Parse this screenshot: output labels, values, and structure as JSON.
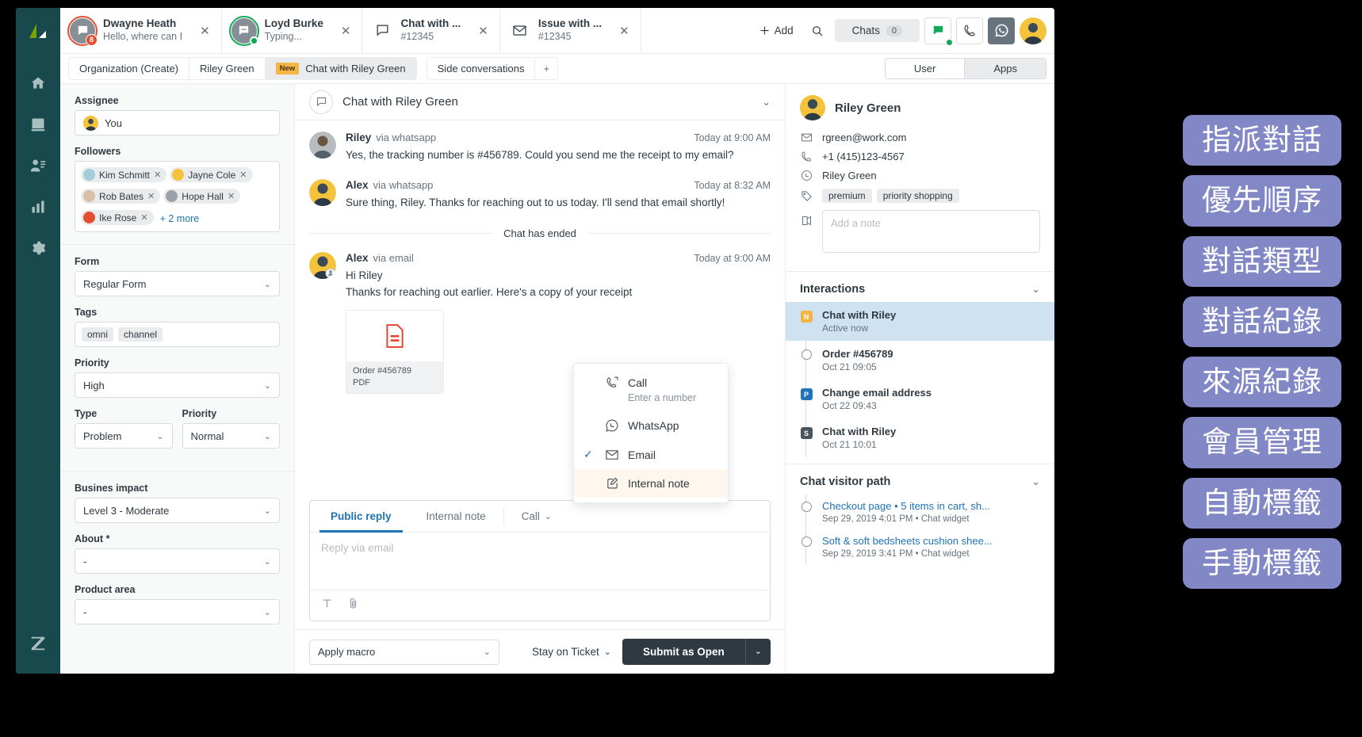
{
  "rail": {
    "items": [
      {
        "name": "logo",
        "label": "Zendesk logo"
      },
      {
        "name": "home",
        "label": "Home"
      },
      {
        "name": "views",
        "label": "Views"
      },
      {
        "name": "customers",
        "label": "Customers"
      },
      {
        "name": "reporting",
        "label": "Reporting"
      },
      {
        "name": "admin",
        "label": "Admin"
      }
    ],
    "bottom_label": "Zendesk"
  },
  "top_tabs": [
    {
      "title": "Dwayne Heath",
      "sub": "Hello, where can I",
      "badge": "8",
      "kind": "avatar-red"
    },
    {
      "title": "Loyd Burke",
      "sub": "Typing...",
      "badge": "",
      "kind": "avatar-green"
    },
    {
      "title": "Chat with ...",
      "sub": "#12345",
      "badge": "",
      "kind": "chat-icon"
    },
    {
      "title": "Issue with ...",
      "sub": "#12345",
      "badge": "",
      "kind": "mail-icon"
    }
  ],
  "top_actions": {
    "add_label": "Add",
    "search_label": "search-icon",
    "chats_label": "Chats",
    "chats_count": "0"
  },
  "crumbs": {
    "items": [
      {
        "label": "Organization (Create)",
        "active": false,
        "badge": ""
      },
      {
        "label": "Riley Green",
        "active": false,
        "badge": ""
      },
      {
        "label": "Chat with Riley Green",
        "active": true,
        "badge": "New"
      }
    ],
    "side_conversations": "Side conversations",
    "add": "+",
    "segment": {
      "left": "User",
      "right": "Apps",
      "selected": "Apps"
    }
  },
  "props": {
    "assignee_label": "Assignee",
    "assignee_value": "You",
    "followers_label": "Followers",
    "followers": [
      {
        "name": "Kim Schmitt",
        "color": "#a3cdd9"
      },
      {
        "name": "Jayne Cole",
        "color": "#f5c33b"
      },
      {
        "name": "Rob Bates",
        "color": "#d9bfa8"
      },
      {
        "name": "Hope Hall",
        "color": "#9aa2a8"
      },
      {
        "name": "Ike Rose",
        "color": "#e34f32"
      }
    ],
    "followers_more": "+ 2 more",
    "form_label": "Form",
    "form_value": "Regular Form",
    "tags_label": "Tags",
    "tags": [
      "omni",
      "channel"
    ],
    "priority_label": "Priority",
    "priority_value": "High",
    "type_label": "Type",
    "type_value": "Problem",
    "priority2_label": "Priority",
    "priority2_value": "Normal",
    "business_impact_label": "Busines impact",
    "business_impact_value": "Level 3 - Moderate",
    "about_label": "About *",
    "about_value": "-",
    "product_area_label": "Product area",
    "product_area_value": "-"
  },
  "conversation": {
    "title": "Chat with Riley Green",
    "messages": [
      {
        "name": "Riley",
        "via": "via whatsapp",
        "time": "Today at 9:00 AM",
        "text": "Yes, the tracking number is #456789. Could you send me the receipt to my email?",
        "avatar_color": "#b8bcbf",
        "agent": false
      },
      {
        "name": "Alex",
        "via": "via whatsapp",
        "time": "Today at 8:32 AM",
        "text": "Sure thing, Riley. Thanks for reaching out to us today. I'll send that email shortly!",
        "avatar_color": "#f5c33b",
        "agent": true
      }
    ],
    "ended_label": "Chat has ended",
    "email_message": {
      "name": "Alex",
      "via": "via email",
      "time": "Today at 9:00 AM",
      "line1": "Hi Riley",
      "line2": "Thanks for reaching out earlier. Here's a copy of your receipt",
      "avatar_color": "#f5c33b"
    },
    "attachment": {
      "name": "Order #456789",
      "type": "PDF"
    }
  },
  "channel_menu": {
    "items": [
      {
        "label": "Call",
        "sub": "Enter a number",
        "icon": "phone-icon",
        "checked": false,
        "highlight": false
      },
      {
        "label": "WhatsApp",
        "sub": "",
        "icon": "whatsapp-icon",
        "checked": false,
        "highlight": false
      },
      {
        "label": "Email",
        "sub": "",
        "icon": "mail-icon",
        "checked": true,
        "highlight": false
      },
      {
        "label": "Internal note",
        "sub": "",
        "icon": "note-icon",
        "checked": false,
        "highlight": true
      }
    ]
  },
  "composer": {
    "tabs": [
      {
        "label": "Public reply",
        "active": true
      },
      {
        "label": "Internal note",
        "active": false
      },
      {
        "label": "Call",
        "active": false,
        "has_chevron": true
      }
    ],
    "placeholder": "Reply via email",
    "tool_text": "text-format-icon",
    "tool_attach": "attachment-icon"
  },
  "bottom_bar": {
    "macro_placeholder": "Apply macro",
    "stay_label": "Stay on Ticket",
    "submit_label": "Submit as Open"
  },
  "context": {
    "user_name": "Riley Green",
    "email": "rgreen@work.com",
    "phone": "+1 (415)123-4567",
    "whatsapp": "Riley Green",
    "tags": [
      "premium",
      "priority shopping"
    ],
    "note_placeholder": "Add a note",
    "interactions_title": "Interactions",
    "interactions": [
      {
        "title": "Chat with Riley",
        "sub": "Active now",
        "badge": "N",
        "badge_color": "#f5b544",
        "selected": true
      },
      {
        "title": "Order #456789",
        "sub": "Oct 21 09:05",
        "badge": "",
        "badge_color": "",
        "selected": false
      },
      {
        "title": "Change email address",
        "sub": "Oct 22 09:43",
        "badge": "P",
        "badge_color": "#1f73b7",
        "selected": false
      },
      {
        "title": "Chat with Riley",
        "sub": "Oct 21 10:01",
        "badge": "S",
        "badge_color": "#49545c",
        "selected": false
      }
    ],
    "path_title": "Chat visitor path",
    "path": [
      {
        "title": "Checkout page • 5 items in cart, sh...",
        "sub": "Sep 29, 2019 4:01 PM • Chat widget"
      },
      {
        "title": "Soft & soft bedsheets cushion shee...",
        "sub": "Sep 29, 2019 3:41 PM • Chat widget"
      }
    ]
  },
  "callout_labels": [
    "指派對話",
    "優先順序",
    "對話類型",
    "對話紀錄",
    "來源紀錄",
    "會員管理",
    "自動標籤",
    "手動標籤"
  ],
  "colors": {
    "brand": "#17494d",
    "accent": "#1f73b7",
    "highlight": "#cee2f2",
    "label_bg": "#8287c6",
    "new_badge": "#f5b544"
  }
}
